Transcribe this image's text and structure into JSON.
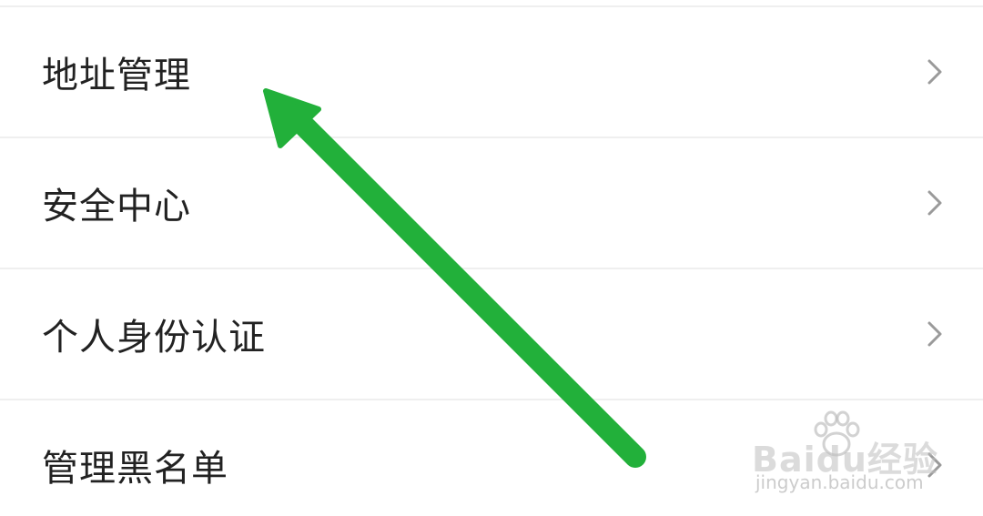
{
  "menu": {
    "items": [
      {
        "label": "地址管理"
      },
      {
        "label": "安全中心"
      },
      {
        "label": "个人身份认证"
      },
      {
        "label": "管理黑名单"
      }
    ]
  },
  "watermark": {
    "brand": "Baidu经验",
    "url": "jingyan.baidu.com"
  },
  "colors": {
    "arrow": "#22b03a",
    "divider": "#efefef",
    "label": "#222222",
    "chevron": "#9a9a9a"
  }
}
